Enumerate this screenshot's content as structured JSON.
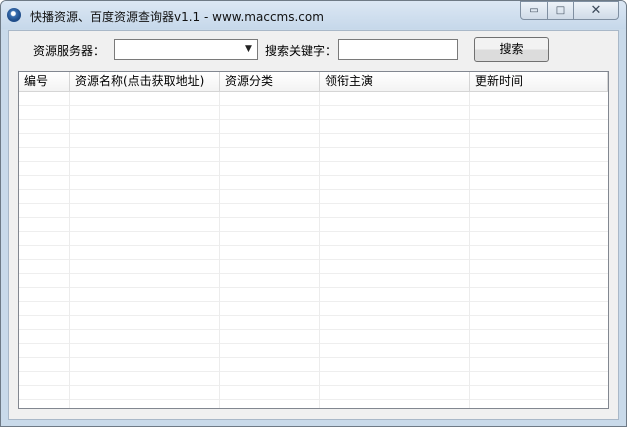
{
  "window": {
    "title": "快播资源、百度资源查询器v1.1 - www.maccms.com",
    "controls": {
      "minimize": "▭",
      "maximize": "□",
      "close": "✕"
    }
  },
  "search": {
    "server_label": "资源服务器：",
    "server_value": "",
    "keyword_label": "搜索关键字：",
    "keyword_value": "",
    "button_label": "搜索"
  },
  "table": {
    "columns": [
      "编号",
      "资源名称(点击获取地址)",
      "资源分类",
      "领衔主演",
      "更新时间"
    ],
    "rows": []
  }
}
